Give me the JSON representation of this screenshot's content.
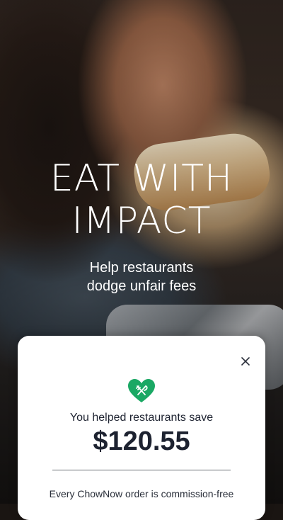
{
  "hero": {
    "headline_line1": "EAT WITH",
    "headline_line2": "IMPACT",
    "subhead_line1": "Help restaurants",
    "subhead_line2": "dodge unfair fees"
  },
  "modal": {
    "close_icon": "close-icon",
    "heart_icon": "heart-fork-knife-icon",
    "saved_label": "You helped restaurants save",
    "saved_amount": "$120.55",
    "footnote": "Every ChowNow order is commission-free",
    "footnote_cont": ""
  },
  "colors": {
    "accent_green": "#1aa864",
    "text_dark": "#1d2230",
    "card_bg": "#ffffff"
  }
}
